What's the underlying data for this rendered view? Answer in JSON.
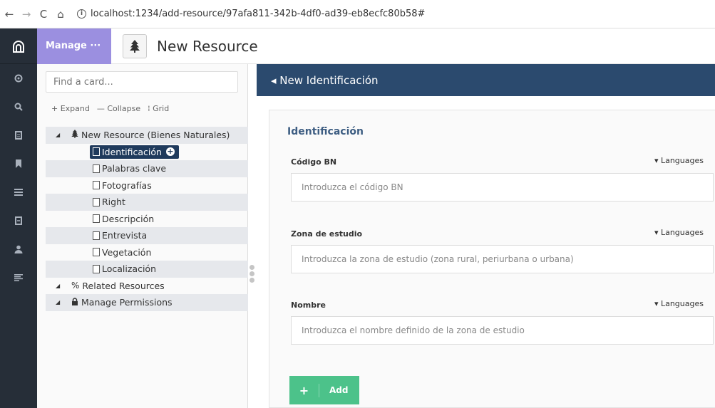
{
  "browser": {
    "back": "←",
    "forward": "→",
    "reload": "C",
    "home": "⌂",
    "url": "localhost:1234/add-resource/97afa811-342b-4df0-ad39-eb8ecfc80b58#"
  },
  "header": {
    "manage_label": "Manage ···",
    "title": "New Resource"
  },
  "tree": {
    "search_placeholder": "Find a card...",
    "expand": "+ Expand",
    "collapse": "— Collapse",
    "grid": "⁞ Grid",
    "root": "New Resource (Bienes Naturales)",
    "selected": "Identificación",
    "children": [
      "Palabras clave",
      "Fotografías",
      "Right",
      "Descripción",
      "Entrevista",
      "Vegetación",
      "Localización"
    ],
    "related": "Related Resources",
    "permissions": "Manage Permissions"
  },
  "form": {
    "back_title": "◂ New Identificación",
    "card_title": "Identificación",
    "languages_label": "▾ Languages",
    "add_label": "Add",
    "fields": [
      {
        "label": "Código BN",
        "placeholder": "Introduzca el código BN"
      },
      {
        "label": "Zona de estudio",
        "placeholder": "Introduzca la zona de estudio (zona rural, periurbana o urbana)"
      },
      {
        "label": "Nombre",
        "placeholder": "Introduzca el nombre definido de la zona de estudio"
      }
    ]
  },
  "colors": {
    "rail": "#262e38",
    "manage": "#9b8fe0",
    "form_header": "#2b4a6e",
    "selected": "#1f3a5c",
    "add_button": "#4cc28a"
  }
}
